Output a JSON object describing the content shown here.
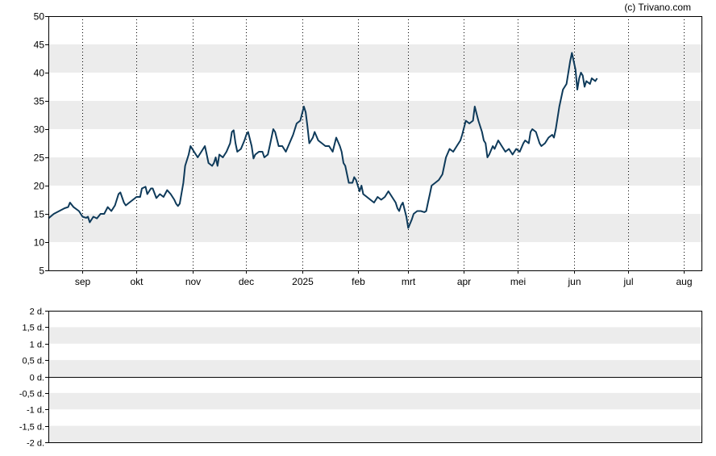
{
  "credit": "(c) Trivano.com",
  "chart_data": [
    {
      "type": "line",
      "ylim": [
        5,
        50
      ],
      "y_ticks": [
        5,
        10,
        15,
        20,
        25,
        30,
        35,
        40,
        45,
        50
      ],
      "x_ticks": [
        {
          "label": "sep",
          "day": 14
        },
        {
          "label": "okt",
          "day": 44
        },
        {
          "label": "nov",
          "day": 75
        },
        {
          "label": "dec",
          "day": 105
        },
        {
          "label": "2025",
          "day": 136
        },
        {
          "label": "feb",
          "day": 167
        },
        {
          "label": "mrt",
          "day": 195
        },
        {
          "label": "apr",
          "day": 226
        },
        {
          "label": "mei",
          "day": 256
        },
        {
          "label": "jun",
          "day": 287
        },
        {
          "label": "jul",
          "day": 317
        },
        {
          "label": "aug",
          "day": 348
        }
      ],
      "x_range": [
        -5,
        358
      ],
      "grid_vertical": "dotted",
      "horizontal_bands": true,
      "line_color": "#0e3a5a",
      "series": [
        {
          "values": [
            [
              -5,
              14.2
            ],
            [
              -2,
              15.0
            ],
            [
              1,
              15.5
            ],
            [
              4,
              16.0
            ],
            [
              6,
              16.2
            ],
            [
              7,
              17.0
            ],
            [
              9,
              16.2
            ],
            [
              12,
              15.5
            ],
            [
              14,
              14.5
            ],
            [
              16,
              14.3
            ],
            [
              17,
              14.5
            ],
            [
              18,
              13.5
            ],
            [
              20,
              14.5
            ],
            [
              22,
              14.2
            ],
            [
              24,
              15.0
            ],
            [
              26,
              15.0
            ],
            [
              28,
              16.2
            ],
            [
              30,
              15.5
            ],
            [
              32,
              16.5
            ],
            [
              34,
              18.5
            ],
            [
              35,
              18.8
            ],
            [
              37,
              17.0
            ],
            [
              38,
              16.5
            ],
            [
              40,
              17.0
            ],
            [
              42,
              17.5
            ],
            [
              44,
              18.0
            ],
            [
              46,
              18.0
            ],
            [
              47,
              19.5
            ],
            [
              49,
              19.8
            ],
            [
              50,
              18.5
            ],
            [
              52,
              19.5
            ],
            [
              53,
              19.5
            ],
            [
              55,
              17.8
            ],
            [
              57,
              18.5
            ],
            [
              59,
              18.0
            ],
            [
              61,
              19.2
            ],
            [
              63,
              18.5
            ],
            [
              65,
              17.5
            ],
            [
              66,
              16.8
            ],
            [
              67,
              16.4
            ],
            [
              68,
              16.8
            ],
            [
              70,
              20.5
            ],
            [
              71,
              23.5
            ],
            [
              73,
              25.5
            ],
            [
              74,
              27.0
            ],
            [
              76,
              26.0
            ],
            [
              78,
              25.0
            ],
            [
              80,
              26.0
            ],
            [
              82,
              27.0
            ],
            [
              83,
              25.5
            ],
            [
              84,
              24.0
            ],
            [
              86,
              23.5
            ],
            [
              87,
              24.0
            ],
            [
              88,
              25.0
            ],
            [
              89,
              23.5
            ],
            [
              90,
              25.5
            ],
            [
              92,
              25.0
            ],
            [
              94,
              26.0
            ],
            [
              96,
              27.5
            ],
            [
              97,
              29.5
            ],
            [
              98,
              29.8
            ],
            [
              99,
              27.5
            ],
            [
              100,
              26.0
            ],
            [
              102,
              26.5
            ],
            [
              104,
              28.0
            ],
            [
              105,
              29.0
            ],
            [
              106,
              29.5
            ],
            [
              108,
              27.0
            ],
            [
              109,
              24.8
            ],
            [
              110,
              25.5
            ],
            [
              112,
              26.0
            ],
            [
              114,
              26.0
            ],
            [
              115,
              25.0
            ],
            [
              117,
              25.5
            ],
            [
              118,
              27.0
            ],
            [
              120,
              30.0
            ],
            [
              121,
              29.5
            ],
            [
              123,
              27.0
            ],
            [
              125,
              27.0
            ],
            [
              127,
              26.0
            ],
            [
              129,
              27.5
            ],
            [
              131,
              29.0
            ],
            [
              133,
              31.0
            ],
            [
              135,
              31.5
            ],
            [
              137,
              34.0
            ],
            [
              138,
              33.0
            ],
            [
              139,
              30.5
            ],
            [
              140,
              27.5
            ],
            [
              142,
              28.5
            ],
            [
              143,
              29.5
            ],
            [
              145,
              28.0
            ],
            [
              147,
              27.5
            ],
            [
              149,
              27.0
            ],
            [
              151,
              27.0
            ],
            [
              153,
              26.0
            ],
            [
              155,
              28.5
            ],
            [
              157,
              27.0
            ],
            [
              158,
              26.0
            ],
            [
              159,
              24.0
            ],
            [
              160,
              23.5
            ],
            [
              161,
              22.0
            ],
            [
              162,
              20.5
            ],
            [
              164,
              20.5
            ],
            [
              165,
              21.5
            ],
            [
              166,
              21.0
            ],
            [
              167,
              20.0
            ],
            [
              168,
              19.0
            ],
            [
              169,
              20.0
            ],
            [
              170,
              18.5
            ],
            [
              172,
              18.0
            ],
            [
              174,
              17.5
            ],
            [
              176,
              17.0
            ],
            [
              178,
              18.0
            ],
            [
              180,
              17.5
            ],
            [
              182,
              18.0
            ],
            [
              184,
              19.0
            ],
            [
              186,
              18.0
            ],
            [
              188,
              17.0
            ],
            [
              189,
              16.0
            ],
            [
              190,
              15.5
            ],
            [
              191,
              16.5
            ],
            [
              192,
              17.0
            ],
            [
              194,
              14.5
            ],
            [
              195,
              12.5
            ],
            [
              197,
              14.0
            ],
            [
              198,
              15.0
            ],
            [
              200,
              15.5
            ],
            [
              202,
              15.5
            ],
            [
              204,
              15.3
            ],
            [
              205,
              15.5
            ],
            [
              206,
              17.0
            ],
            [
              207,
              18.5
            ],
            [
              208,
              20.0
            ],
            [
              210,
              20.5
            ],
            [
              212,
              21.0
            ],
            [
              214,
              22.0
            ],
            [
              215,
              23.5
            ],
            [
              216,
              25.0
            ],
            [
              218,
              26.5
            ],
            [
              220,
              26.0
            ],
            [
              222,
              27.0
            ],
            [
              224,
              28.0
            ],
            [
              225,
              29.0
            ],
            [
              227,
              31.5
            ],
            [
              229,
              31.0
            ],
            [
              231,
              31.5
            ],
            [
              232,
              34.0
            ],
            [
              234,
              31.5
            ],
            [
              236,
              29.5
            ],
            [
              237,
              28.0
            ],
            [
              238,
              27.5
            ],
            [
              239,
              25.0
            ],
            [
              240,
              25.5
            ],
            [
              242,
              27.0
            ],
            [
              243,
              26.5
            ],
            [
              245,
              28.0
            ],
            [
              247,
              27.0
            ],
            [
              249,
              26.0
            ],
            [
              251,
              26.5
            ],
            [
              253,
              25.5
            ],
            [
              255,
              26.5
            ],
            [
              257,
              26.0
            ],
            [
              259,
              27.5
            ],
            [
              260,
              28.0
            ],
            [
              262,
              27.5
            ],
            [
              263,
              29.5
            ],
            [
              264,
              30.0
            ],
            [
              266,
              29.5
            ],
            [
              268,
              27.5
            ],
            [
              269,
              27.0
            ],
            [
              271,
              27.5
            ],
            [
              273,
              28.5
            ],
            [
              275,
              29.0
            ],
            [
              276,
              28.5
            ],
            [
              277,
              30.0
            ],
            [
              279,
              34.0
            ],
            [
              281,
              37.0
            ],
            [
              283,
              38.0
            ],
            [
              285,
              42.0
            ],
            [
              286,
              43.5
            ],
            [
              288,
              40.5
            ],
            [
              289,
              37.0
            ],
            [
              290,
              39.0
            ],
            [
              291,
              40.0
            ],
            [
              292,
              39.5
            ],
            [
              293,
              37.5
            ],
            [
              294,
              38.5
            ],
            [
              296,
              38.0
            ],
            [
              297,
              39.0
            ],
            [
              299,
              38.5
            ],
            [
              300,
              39.0
            ]
          ]
        }
      ]
    },
    {
      "type": "line",
      "ylim": [
        -2,
        2
      ],
      "y_ticks": [
        {
          "value": 2,
          "label": "2 d."
        },
        {
          "value": 1.5,
          "label": "1,5 d."
        },
        {
          "value": 1,
          "label": "1 d."
        },
        {
          "value": 0.5,
          "label": "0,5 d."
        },
        {
          "value": 0,
          "label": "0 d."
        },
        {
          "value": -0.5,
          "label": "-0,5 d."
        },
        {
          "value": -1,
          "label": "-1 d."
        },
        {
          "value": -1.5,
          "label": "-1,5 d."
        },
        {
          "value": -2,
          "label": "-2 d."
        }
      ],
      "horizontal_bands": true,
      "series": [
        {
          "values": [
            0,
            0
          ]
        }
      ]
    }
  ]
}
